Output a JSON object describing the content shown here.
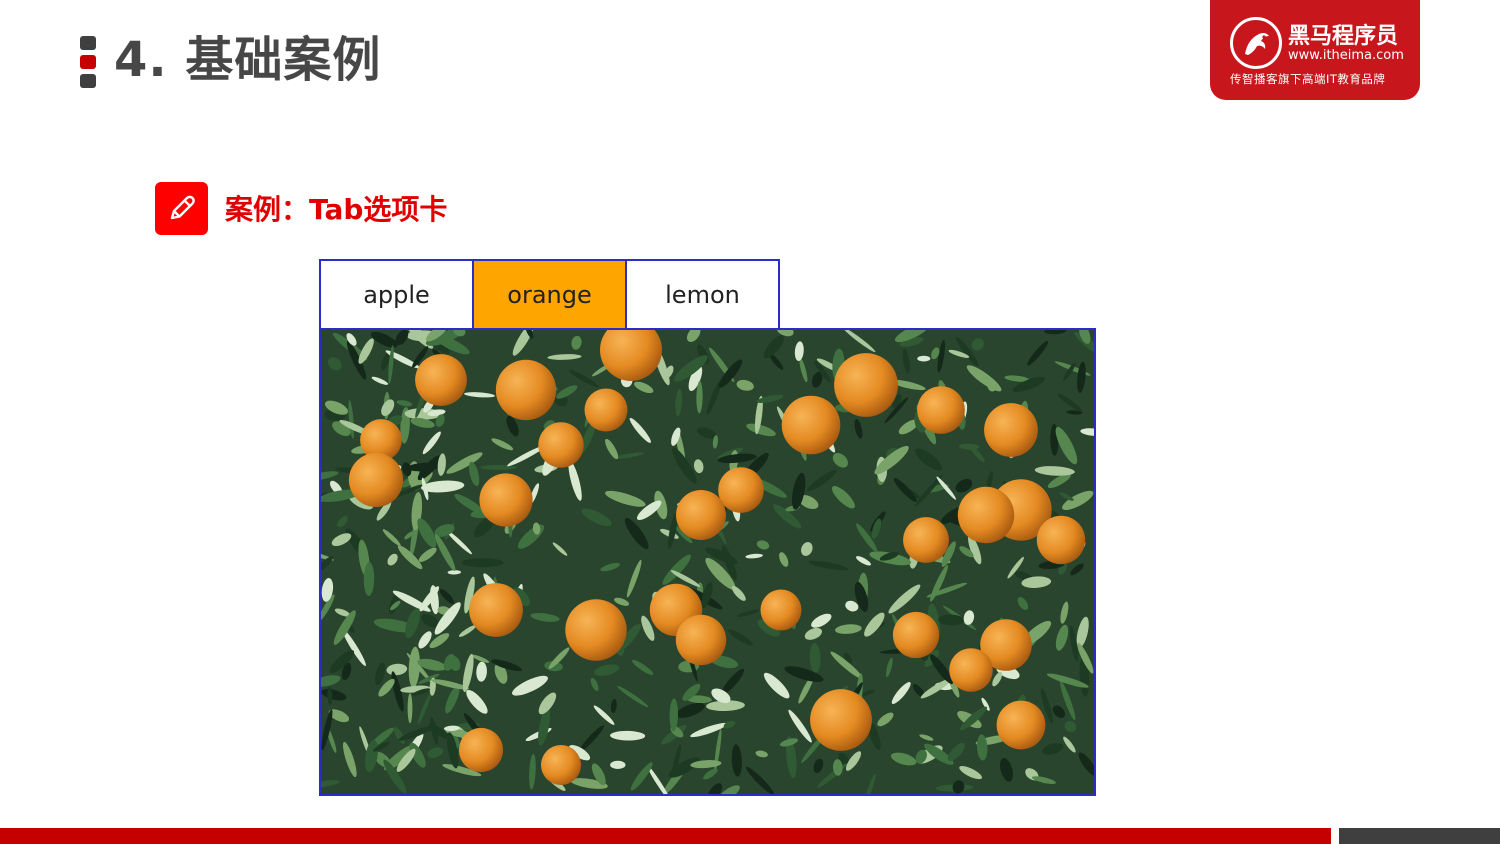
{
  "slide": {
    "section_title": "4. 基础案例",
    "case_title": "案例：Tab选项卡"
  },
  "brand": {
    "name": "黑马程序员",
    "url": "www.itheima.com",
    "slogan": "传智播客旗下高端IT教育品牌"
  },
  "tabs": [
    {
      "label": "apple",
      "active": false
    },
    {
      "label": "orange",
      "active": true
    },
    {
      "label": "lemon",
      "active": false
    }
  ],
  "panel": {
    "image": "orange-tree-photo"
  },
  "colors": {
    "accent_red": "#c40000",
    "active_tab": "#ffa500",
    "tab_border": "#2c2cc6",
    "heading_gray": "#474747"
  }
}
